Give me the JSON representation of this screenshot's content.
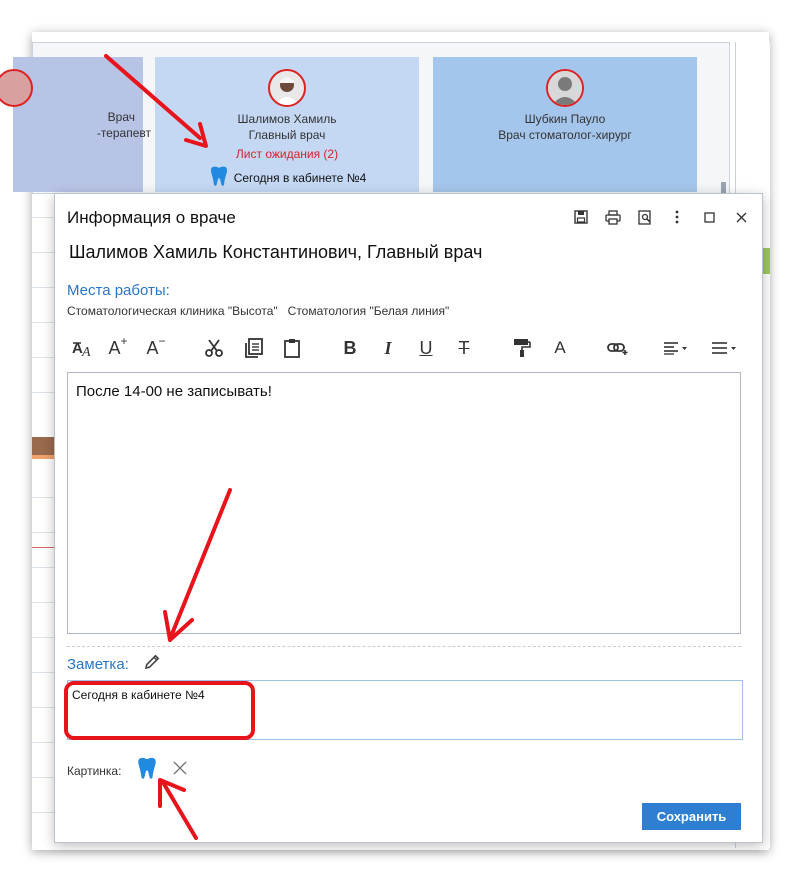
{
  "background": {
    "cards": [
      {
        "name": "Врач",
        "role": "-терапевт"
      },
      {
        "name": "Шалимов Хамиль",
        "role": "Главный врач",
        "waitlist": "Лист ожидания (2)",
        "today": "Сегодня в кабинете №4"
      },
      {
        "name": "Шубкин Пауло",
        "role": "Врач стоматолог-хирург"
      }
    ]
  },
  "dialog": {
    "title": "Информация о враче",
    "actions": [
      "save-icon",
      "print-icon",
      "preview-icon",
      "more-icon",
      "maximize-icon",
      "close-icon"
    ],
    "doctor_full": "Шалимов Хамиль Константинович, Главный врач",
    "workplaces_label": "Места работы:",
    "workplaces": [
      "Стоматологическая клиника \"Высота\"",
      "Стоматология \"Белая линия\""
    ],
    "toolbar": [
      "font-size-icon",
      "font-increase-icon",
      "font-decrease-icon",
      "cut-icon",
      "copy-icon",
      "paste-icon",
      "bold-icon",
      "italic-icon",
      "underline-icon",
      "strikethrough-icon",
      "format-painter-icon",
      "font-color-icon",
      "link-icon",
      "align-icon",
      "list-icon"
    ],
    "toolbar_labels": {
      "font_size": "A",
      "increase": "A",
      "decrease": "A",
      "bold": "B",
      "italic": "I",
      "underline": "U",
      "strike": "T",
      "color": "A"
    },
    "editor_text": "После 14-00 не записывать!",
    "note_label": "Заметка:",
    "note_text": "Сегодня в кабинете №4",
    "picture_label": "Картинка:",
    "save_button": "Сохранить"
  },
  "colors": {
    "accent": "#2e7fd1",
    "label_blue": "#2a76c6",
    "waitlist_red": "#d8222c",
    "annotation_red": "#e8141c",
    "tooth_blue": "#1f8ae0"
  }
}
